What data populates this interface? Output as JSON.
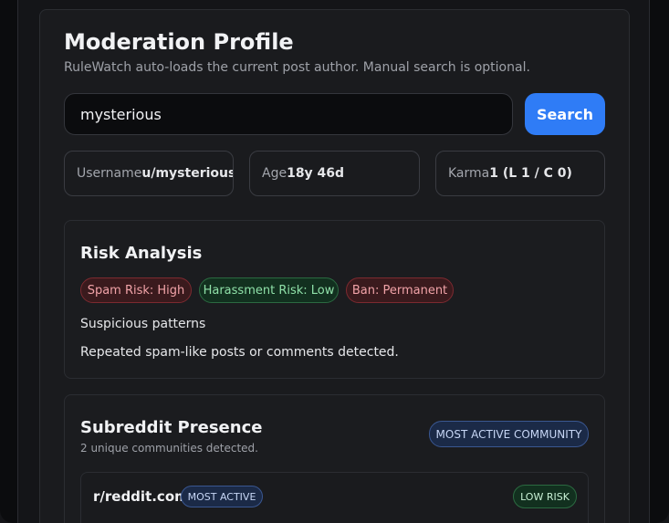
{
  "header": {
    "title": "Moderation Profile",
    "subtitle": "RuleWatch auto-loads the current post author. Manual search is optional."
  },
  "search": {
    "value": "mysterious",
    "button_label": "Search"
  },
  "stats": [
    {
      "label": "Username",
      "value": "u/mysterious"
    },
    {
      "label": "Age",
      "value": "18y 46d"
    },
    {
      "label": "Karma",
      "value": "1 (L 1 / C 0)"
    }
  ],
  "risk": {
    "title": "Risk Analysis",
    "pills": [
      {
        "label": "Spam Risk: High",
        "status": "red"
      },
      {
        "label": "Harassment Risk: Low",
        "status": "green"
      },
      {
        "label": "Ban: Permanent",
        "status": "red"
      }
    ],
    "pattern_heading": "Suspicious patterns",
    "pattern_detail": "Repeated spam-like posts or comments detected."
  },
  "presence": {
    "title": "Subreddit Presence",
    "summary": "2 unique communities detected.",
    "header_badge": "MOST ACTIVE COMMUNITY",
    "items": [
      {
        "name": "r/reddit.com",
        "tag": "MOST ACTIVE",
        "risk": "LOW RISK"
      }
    ]
  },
  "colors": {
    "accent": "#2f7cf6",
    "danger": "#f1a3a8",
    "success": "#8fe0a8"
  }
}
